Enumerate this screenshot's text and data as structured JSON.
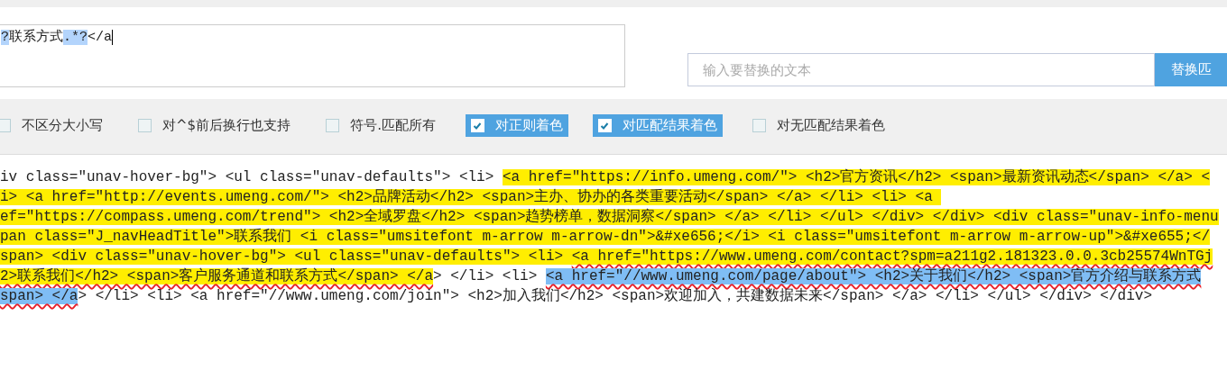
{
  "regex_field": {
    "segments": [
      {
        "text": "?",
        "selected": true
      },
      {
        "text": "联系方式",
        "selected": false
      },
      {
        "text": ".*?",
        "selected": true
      },
      {
        "text": "</a",
        "selected": false
      }
    ]
  },
  "replace": {
    "placeholder": "输入要替换的文本",
    "button": "替换匹"
  },
  "options": [
    {
      "label": "不区分大小写",
      "checked": false
    },
    {
      "label": "对^$前后换行也支持",
      "checked": false
    },
    {
      "label": "符号.匹配所有",
      "checked": false
    },
    {
      "label": "对正则着色",
      "checked": true
    },
    {
      "label": "对匹配结果着色",
      "checked": true
    },
    {
      "label": "对无匹配结果着色",
      "checked": false
    }
  ],
  "result_lines": [
    [
      {
        "text": "iv class=\"unav-hover-bg\"> <ul class=\"unav-defaults\"> <li> ",
        "matched": false,
        "selected": false,
        "underlined": false
      },
      {
        "text": "<a href=\"https://info.umeng.com/\"> <h2>官方资讯</h2> <span>最新资讯动态</span> </a> <",
        "matched": true,
        "selected": false,
        "underlined": false
      }
    ],
    [
      {
        "text": "i> <a href=\"http://events.umeng.com/\"> <h2>品牌活动</h2> <span>主办、协办的各类重要活动</span> </a> </li> <li> <a ",
        "matched": true,
        "selected": false,
        "underlined": false
      }
    ],
    [
      {
        "text": "ef=\"https://compass.umeng.com/trend\"> <h2>全域罗盘</h2> <span>趋势榜单，数据洞察</span> </a> </li> </ul> </div> </div> <div class=\"unav-info-menu",
        "matched": true,
        "selected": false,
        "underlined": false
      }
    ],
    [
      {
        "text": "pan class=\"J_navHeadTitle\">联系我们 <i class=\"umsitefont m-arrow m-arrow-dn\">&#xe656;</i> <i class=\"umsitefont m-arrow m-arrow-up\">&#xe655;</",
        "matched": true,
        "selected": false,
        "underlined": false
      }
    ],
    [
      {
        "text": "span> <div class=\"unav-hover-bg\"> <ul class=\"unav-defaults\"> <li> ",
        "matched": true,
        "selected": false,
        "underlined": false
      },
      {
        "text": "<a href=\"https://www.umeng.com/contact?spm=a211g2.181323.0.0.3cb25574WnTGj",
        "matched": true,
        "selected": false,
        "underlined": true
      }
    ],
    [
      {
        "text": "2>联系我们</h2> <span>客户服务通道和联系方式</span> </a",
        "matched": true,
        "selected": false,
        "underlined": true
      },
      {
        "text": "> </li> <li> ",
        "matched": false,
        "selected": false,
        "underlined": false
      },
      {
        "text": "<a href=\"//www.umeng.com/page/about\"> <h2>关于我们</h2> <span>官方介绍与联系方式",
        "matched": false,
        "selected": true,
        "underlined": true
      }
    ],
    [
      {
        "text": "span> </a",
        "matched": false,
        "selected": true,
        "underlined": true
      },
      {
        "text": "> </li> <li> <a href=\"//www.umeng.com/join\"> <h2>加入我们</h2> <span>欢迎加入，共建数据未来</span> </a> </li> </ul> </div> </div>",
        "matched": false,
        "selected": false,
        "underlined": false
      }
    ]
  ]
}
